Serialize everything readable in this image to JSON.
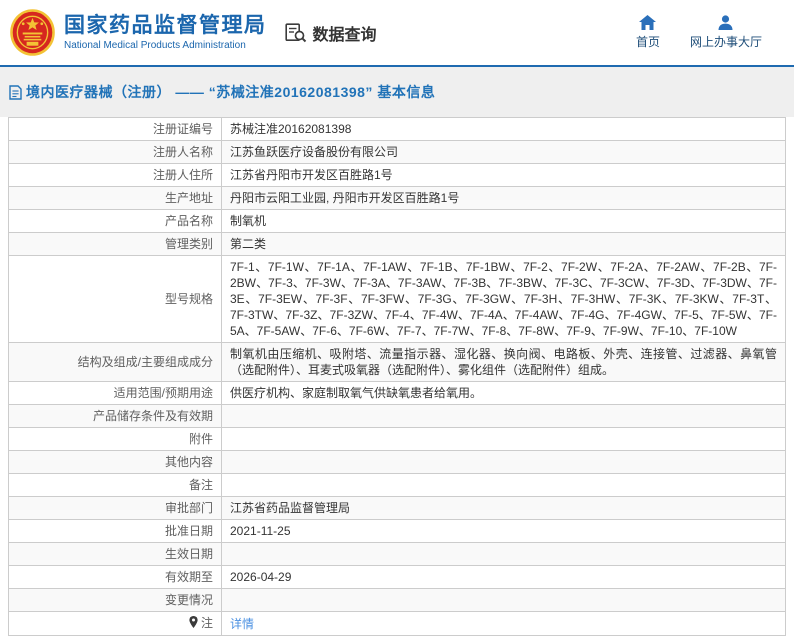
{
  "header": {
    "agency_name_cn": "国家药品监督管理局",
    "agency_name_en": "National Medical Products Administration",
    "data_query_label": "数据查询",
    "nav": [
      {
        "label": "首页",
        "icon": "home-icon"
      },
      {
        "label": "网上办事大厅",
        "icon": "user-icon"
      }
    ]
  },
  "page_title": {
    "icon": "document-icon",
    "text": "境内医疗器械（注册） —— “苏械注准20162081398” 基本信息"
  },
  "table": {
    "rows": [
      {
        "label": "注册证编号",
        "value": "苏械注准20162081398"
      },
      {
        "label": "注册人名称",
        "value": "江苏鱼跃医疗设备股份有限公司"
      },
      {
        "label": "注册人住所",
        "value": "江苏省丹阳市开发区百胜路1号"
      },
      {
        "label": "生产地址",
        "value": "丹阳市云阳工业园, 丹阳市开发区百胜路1号"
      },
      {
        "label": "产品名称",
        "value": "制氧机"
      },
      {
        "label": "管理类别",
        "value": "第二类"
      },
      {
        "label": "型号规格",
        "value": "7F-1、7F-1W、7F-1A、7F-1AW、7F-1B、7F-1BW、7F-2、7F-2W、7F-2A、7F-2AW、7F-2B、7F-2BW、7F-3、7F-3W、7F-3A、7F-3AW、7F-3B、7F-3BW、7F-3C、7F-3CW、7F-3D、7F-3DW、7F-3E、7F-3EW、7F-3F、7F-3FW、7F-3G、7F-3GW、7F-3H、7F-3HW、7F-3K、7F-3KW、7F-3T、7F-3TW、7F-3Z、7F-3ZW、7F-4、7F-4W、7F-4A、7F-4AW、7F-4G、7F-4GW、7F-5、7F-5W、7F-5A、7F-5AW、7F-6、7F-6W、7F-7、7F-7W、7F-8、7F-8W、7F-9、7F-9W、7F-10、7F-10W",
        "justify": true
      },
      {
        "label": "结构及组成/主要组成成分",
        "value": "制氧机由压缩机、吸附塔、流量指示器、湿化器、换向阀、电路板、外壳、连接管、过滤器、鼻氧管（选配附件）、耳麦式吸氧器（选配附件）、雾化组件（选配附件）组成。",
        "justify": true
      },
      {
        "label": "适用范围/预期用途",
        "value": "供医疗机构、家庭制取氧气供缺氧患者给氧用。"
      },
      {
        "label": "产品储存条件及有效期",
        "value": ""
      },
      {
        "label": "附件",
        "value": ""
      },
      {
        "label": "其他内容",
        "value": ""
      },
      {
        "label": "备注",
        "value": ""
      },
      {
        "label": "审批部门",
        "value": "江苏省药品监督管理局"
      },
      {
        "label": "批准日期",
        "value": "2021-11-25"
      },
      {
        "label": "生效日期",
        "value": ""
      },
      {
        "label": "有效期至",
        "value": "2026-04-29"
      },
      {
        "label": "变更情况",
        "value": ""
      },
      {
        "label": "注",
        "value": "详情",
        "link": true,
        "note_icon": true
      }
    ]
  },
  "colors": {
    "accent_blue": "#1e6ab0",
    "title_blue": "#1b66ad",
    "breadcrumb_blue": "#2173b8",
    "link_blue": "#4a90e2",
    "emblem_red": "#d6271f",
    "emblem_gold": "#f3c235",
    "stripe_gray": "#f9f9f9",
    "band_gray": "#efefef",
    "border_gray": "#cccccc"
  }
}
